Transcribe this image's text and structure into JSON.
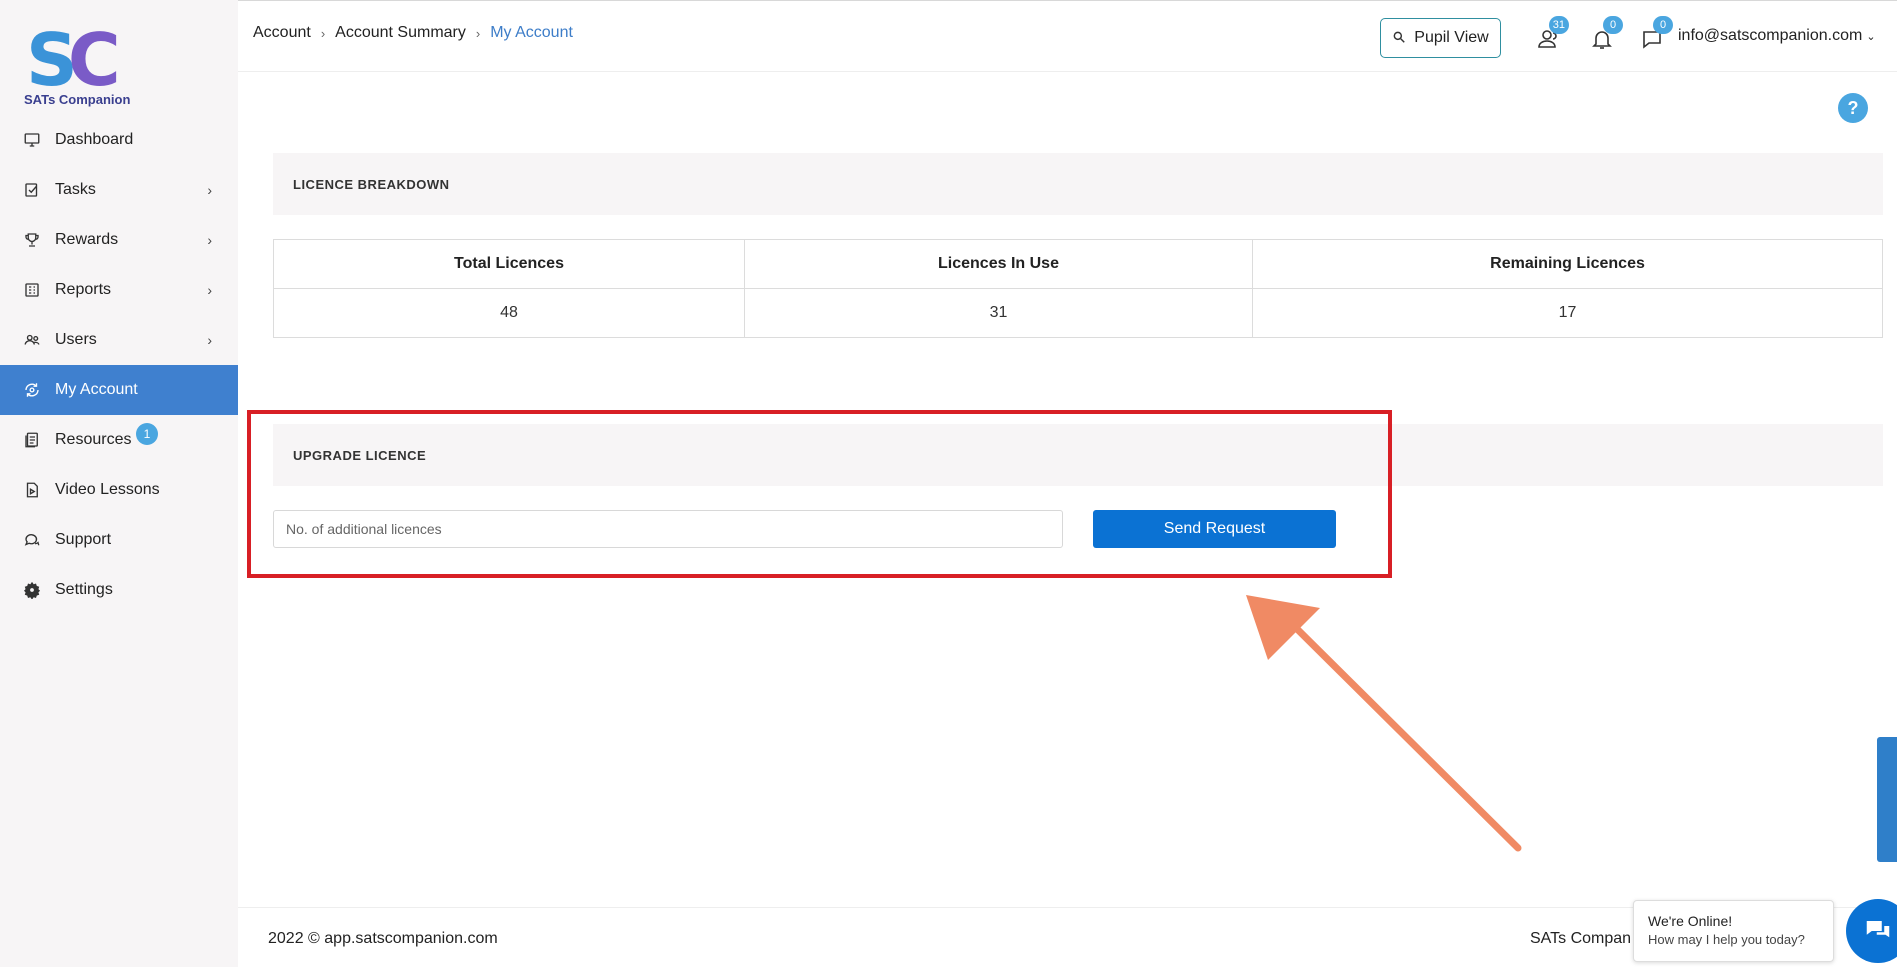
{
  "app": {
    "logo_text": "SATs Companion"
  },
  "sidebar": {
    "items": [
      {
        "label": "Dashboard",
        "icon": "monitor-icon",
        "has_arrow": false
      },
      {
        "label": "Tasks",
        "icon": "tasks-icon",
        "has_arrow": true
      },
      {
        "label": "Rewards",
        "icon": "trophy-icon",
        "has_arrow": true
      },
      {
        "label": "Reports",
        "icon": "reports-icon",
        "has_arrow": true
      },
      {
        "label": "Users",
        "icon": "users-icon",
        "has_arrow": true
      },
      {
        "label": "My Account",
        "icon": "account-icon",
        "has_arrow": false,
        "active": true
      },
      {
        "label": "Resources",
        "icon": "resources-icon",
        "has_arrow": false,
        "badge": "1"
      },
      {
        "label": "Video Lessons",
        "icon": "video-icon",
        "has_arrow": false
      },
      {
        "label": "Support",
        "icon": "chat-icon",
        "has_arrow": false
      },
      {
        "label": "Settings",
        "icon": "gear-icon",
        "has_arrow": false
      }
    ]
  },
  "header": {
    "breadcrumb": [
      "Account",
      "Account Summary",
      "My Account"
    ],
    "pupil_view_label": "Pupil View",
    "users_badge": "31",
    "notifications_badge": "0",
    "messages_badge": "0",
    "user_email": "info@satscompanion.com"
  },
  "licence_breakdown": {
    "title": "LICENCE BREAKDOWN",
    "columns": [
      "Total Licences",
      "Licences In Use",
      "Remaining Licences"
    ],
    "values": [
      "48",
      "31",
      "17"
    ]
  },
  "upgrade_licence": {
    "title": "UPGRADE LICENCE",
    "input_placeholder": "No. of additional licences",
    "input_value": "",
    "button_label": "Send Request"
  },
  "footer": {
    "copyright": "2022 © app.satscompanion.com",
    "right_text": "SATs Compan"
  },
  "chat_widget": {
    "title": "We're Online!",
    "subtitle": "How may I help you today?"
  },
  "colors": {
    "accent": "#3f80cf",
    "badge": "#4aa6e0",
    "button": "#0b72d3",
    "highlight": "#d81f25",
    "arrow": "#f08a64"
  }
}
